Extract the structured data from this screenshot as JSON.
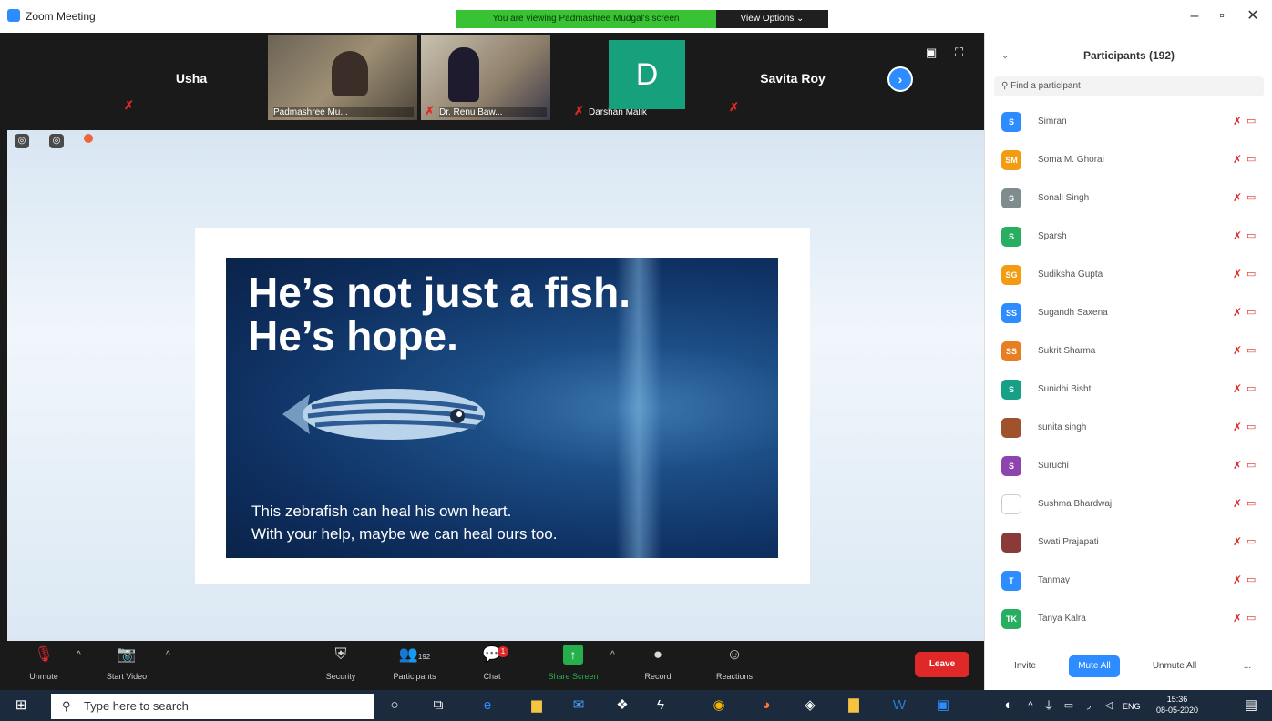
{
  "window": {
    "title": "Zoom Meeting",
    "banner": "You are viewing Padmashree Mudgal's screen",
    "view_options": "View Options ⌄"
  },
  "strip": {
    "tiles": [
      {
        "name": "Usha"
      },
      {
        "name": "Padmashree Mu..."
      },
      {
        "name": "Dr. Renu Baw..."
      },
      {
        "name": "Darshan Malik",
        "initial": "D"
      },
      {
        "name": "Savita Roy"
      }
    ]
  },
  "slide": {
    "headline_1": "He’s not just a fish.",
    "headline_2": "He’s hope.",
    "caption_1": "This zebrafish can heal his own heart.",
    "caption_2": "With your help, maybe we can heal ours too."
  },
  "toolbar": {
    "unmute": "Unmute",
    "start_video": "Start Video",
    "security": "Security",
    "participants": "Participants",
    "participants_count": "192",
    "chat": "Chat",
    "chat_badge": "1",
    "share_screen": "Share Screen",
    "record": "Record",
    "reactions": "Reactions",
    "leave": "Leave"
  },
  "panel": {
    "title": "Participants (192)",
    "search_placeholder": "Find a participant",
    "participants": [
      {
        "initials": "S",
        "name": "Simran",
        "color": "#2d8cff"
      },
      {
        "initials": "SM",
        "name": "Soma M. Ghorai",
        "color": "#f39c12"
      },
      {
        "initials": "S",
        "name": "Sonali Singh",
        "color": "#7f8c8d"
      },
      {
        "initials": "S",
        "name": "Sparsh",
        "color": "#27ae60"
      },
      {
        "initials": "SG",
        "name": "Sudiksha Gupta",
        "color": "#f39c12"
      },
      {
        "initials": "SS",
        "name": "Sugandh Saxena",
        "color": "#2d8cff"
      },
      {
        "initials": "SS",
        "name": "Sukrit Sharma",
        "color": "#e67e22"
      },
      {
        "initials": "S",
        "name": "Sunidhi Bisht",
        "color": "#16a085"
      },
      {
        "initials": "",
        "name": "sunita singh",
        "color": "#a0522d"
      },
      {
        "initials": "S",
        "name": "Suruchi",
        "color": "#8e44ad"
      },
      {
        "initials": "",
        "name": "Sushma Bhardwaj",
        "color": "#ffffff"
      },
      {
        "initials": "",
        "name": "Swati Prajapati",
        "color": "#8b3a3a"
      },
      {
        "initials": "T",
        "name": "Tanmay",
        "color": "#2d8cff"
      },
      {
        "initials": "TK",
        "name": "Tanya Kalra",
        "color": "#27ae60"
      }
    ],
    "invite": "Invite",
    "mute_all": "Mute All",
    "unmute_all": "Unmute All",
    "more": "..."
  },
  "taskbar": {
    "search_placeholder": "Type here to search",
    "lang": "ENG",
    "time": "15:36",
    "date": "08-05-2020"
  }
}
